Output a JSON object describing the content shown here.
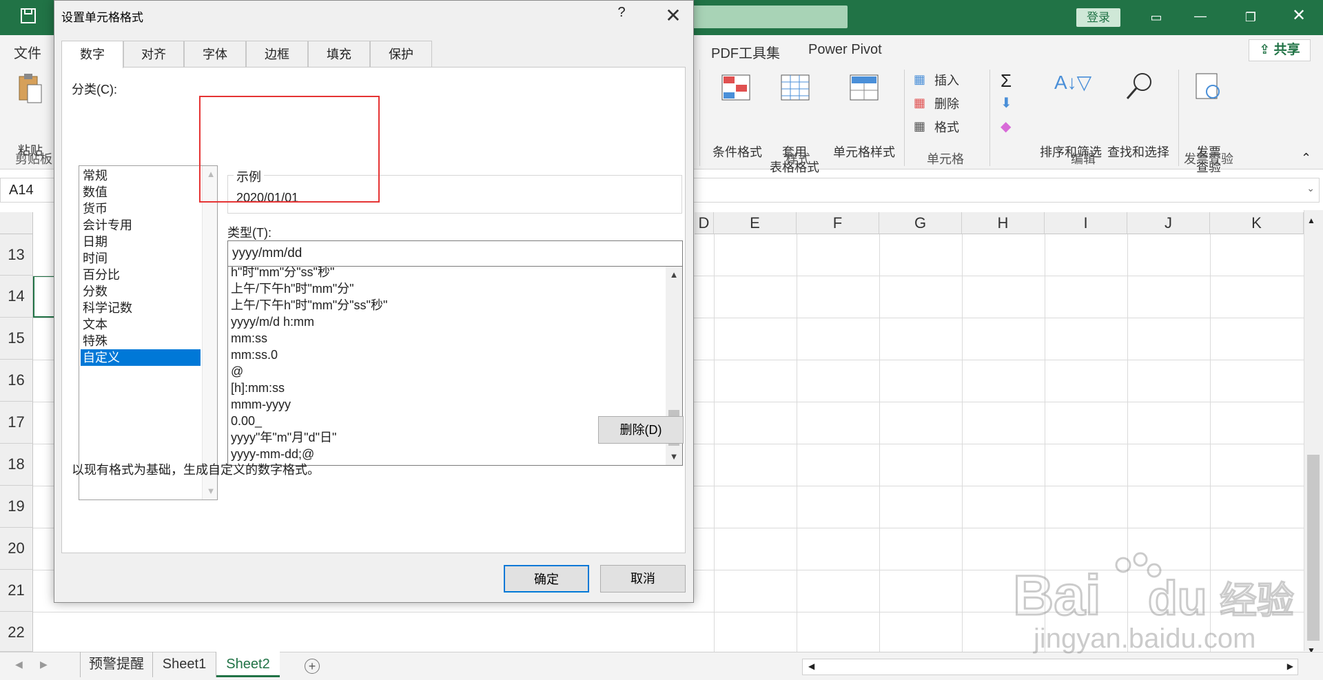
{
  "excel": {
    "login": "登录",
    "share": "共享",
    "tabs": [
      "文件",
      "PDF工具集",
      "Power Pivot"
    ],
    "clipboard": {
      "paste": "粘贴",
      "group": "剪贴板"
    },
    "styles": {
      "conditional": "条件格式",
      "table_1": "套用",
      "table_2": "表格格式",
      "cell_style": "单元格样式",
      "group": "样式"
    },
    "cells": {
      "insert": "插入",
      "delete": "删除",
      "format": "格式",
      "group": "单元格"
    },
    "editing": {
      "sort": "排序和筛选",
      "find": "查找和选择",
      "group": "编辑"
    },
    "invoice": {
      "line1": "发票",
      "line2": "查验",
      "group": "发票查验"
    },
    "namebox": "A14",
    "columns": [
      "D",
      "E",
      "F",
      "G",
      "H",
      "I",
      "J",
      "K"
    ],
    "rows": [
      "13",
      "14",
      "15",
      "16",
      "17",
      "18",
      "19",
      "20",
      "21",
      "22"
    ],
    "sheets": [
      "预警提醒",
      "Sheet1",
      "Sheet2"
    ],
    "active_sheet": "Sheet2"
  },
  "dialog": {
    "title": "设置单元格格式",
    "help": "?",
    "tabs": [
      "数字",
      "对齐",
      "字体",
      "边框",
      "填充",
      "保护"
    ],
    "category_label": "分类(C):",
    "categories": [
      "常规",
      "数值",
      "货币",
      "会计专用",
      "日期",
      "时间",
      "百分比",
      "分数",
      "科学记数",
      "文本",
      "特殊",
      "自定义"
    ],
    "selected_category": "自定义",
    "sample_label": "示例",
    "sample_value": "2020/01/01",
    "type_label": "类型(T):",
    "type_value": "yyyy/mm/dd",
    "formats": [
      "h\"时\"mm\"分\"ss\"秒\"",
      "上午/下午h\"时\"mm\"分\"",
      "上午/下午h\"时\"mm\"分\"ss\"秒\"",
      "yyyy/m/d h:mm",
      "mm:ss",
      "mm:ss.0",
      "@",
      "[h]:mm:ss",
      "mmm-yyyy",
      "0.00_",
      "yyyy\"年\"m\"月\"d\"日\"",
      "yyyy-mm-dd;@"
    ],
    "delete_button": "删除(D)",
    "description": "以现有格式为基础，生成自定义的数字格式。",
    "ok": "确定",
    "cancel": "取消"
  },
  "watermark": {
    "brand": "Bai",
    "brand2": "du",
    "site": "经验",
    "url": "jingyan.baidu.com"
  },
  "colors": {
    "excel_green": "#217346",
    "selection_blue": "#0078d7",
    "highlight_red": "#e53333"
  }
}
